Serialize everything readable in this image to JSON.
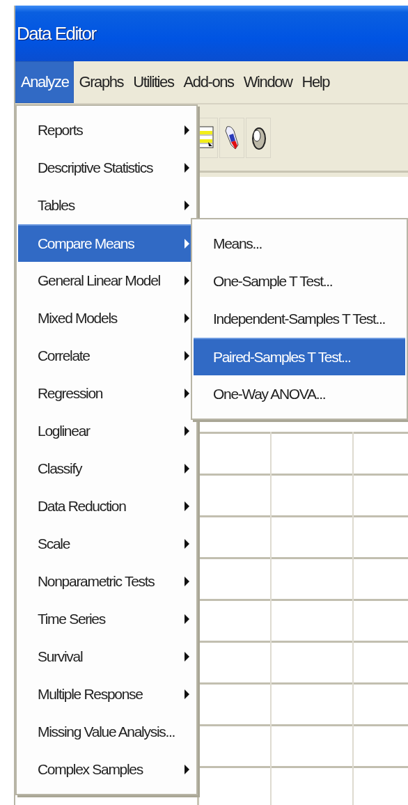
{
  "window": {
    "title": "Data Editor"
  },
  "menubar": [
    {
      "label": "Analyze",
      "selected": true
    },
    {
      "label": "Graphs",
      "selected": false
    },
    {
      "label": "Utilities",
      "selected": false
    },
    {
      "label": "Add-ons",
      "selected": false
    },
    {
      "label": "Window",
      "selected": false
    },
    {
      "label": "Help",
      "selected": false
    }
  ],
  "analyze_menu": [
    {
      "label": "Reports",
      "submenu": true,
      "selected": false
    },
    {
      "label": "Descriptive Statistics",
      "submenu": true,
      "selected": false
    },
    {
      "label": "Tables",
      "submenu": true,
      "selected": false
    },
    {
      "label": "Compare Means",
      "submenu": true,
      "selected": true
    },
    {
      "label": "General Linear Model",
      "submenu": true,
      "selected": false
    },
    {
      "label": "Mixed Models",
      "submenu": true,
      "selected": false
    },
    {
      "label": "Correlate",
      "submenu": true,
      "selected": false
    },
    {
      "label": "Regression",
      "submenu": true,
      "selected": false
    },
    {
      "label": "Loglinear",
      "submenu": true,
      "selected": false
    },
    {
      "label": "Classify",
      "submenu": true,
      "selected": false
    },
    {
      "label": "Data Reduction",
      "submenu": true,
      "selected": false
    },
    {
      "label": "Scale",
      "submenu": true,
      "selected": false
    },
    {
      "label": "Nonparametric Tests",
      "submenu": true,
      "selected": false
    },
    {
      "label": "Time Series",
      "submenu": true,
      "selected": false
    },
    {
      "label": "Survival",
      "submenu": true,
      "selected": false
    },
    {
      "label": "Multiple Response",
      "submenu": true,
      "selected": false
    },
    {
      "label": "Missing Value Analysis...",
      "submenu": false,
      "selected": false
    },
    {
      "label": "Complex Samples",
      "submenu": true,
      "selected": false
    }
  ],
  "compare_means_menu": [
    {
      "label": "Means...",
      "submenu": false,
      "selected": false
    },
    {
      "label": "One-Sample T Test...",
      "submenu": false,
      "selected": false
    },
    {
      "label": "Independent-Samples T Test...",
      "submenu": false,
      "selected": false
    },
    {
      "label": "Paired-Samples T Test...",
      "submenu": false,
      "selected": true
    },
    {
      "label": "One-Way ANOVA...",
      "submenu": false,
      "selected": false
    }
  ]
}
